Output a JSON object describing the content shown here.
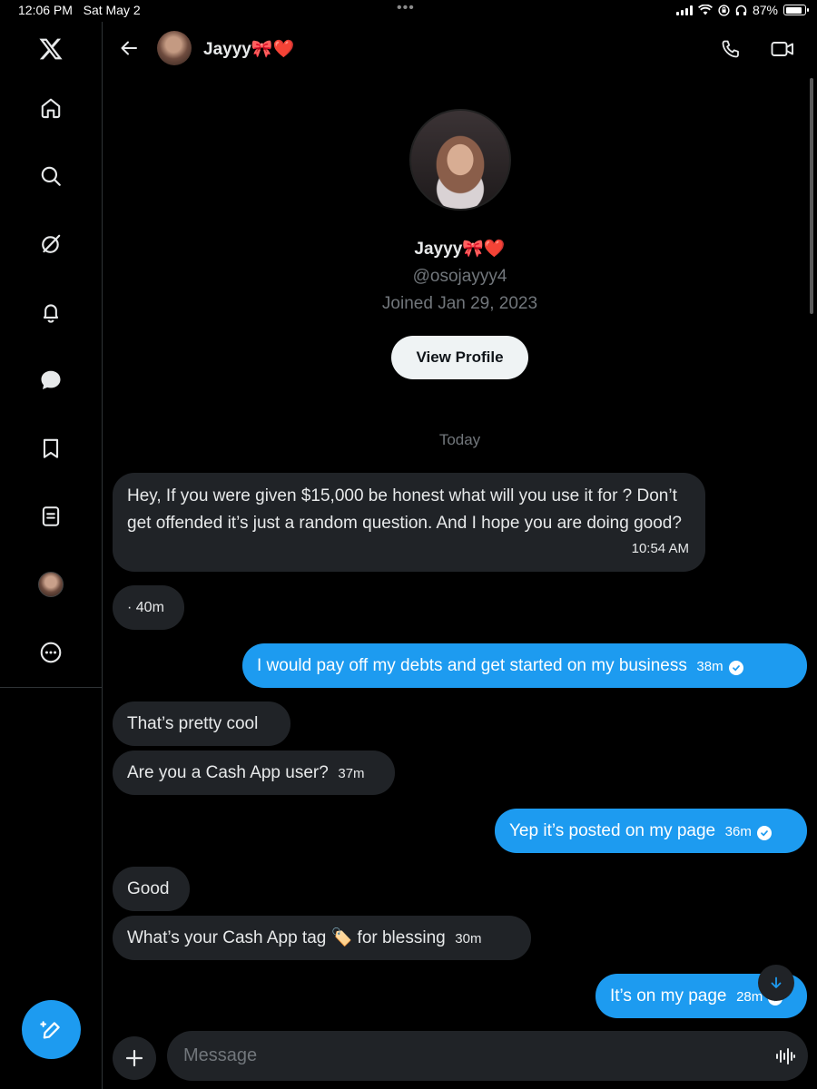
{
  "status_bar": {
    "time": "12:06 PM",
    "date": "Sat May 2",
    "battery": "87%",
    "battery_level": 0.87
  },
  "sidebar": {
    "items": [
      {
        "name": "x-logo-icon"
      },
      {
        "name": "home-icon"
      },
      {
        "name": "search-icon"
      },
      {
        "name": "grok-icon"
      },
      {
        "name": "bell-icon"
      },
      {
        "name": "messages-icon"
      },
      {
        "name": "bookmark-icon"
      },
      {
        "name": "lists-icon"
      },
      {
        "name": "profile-avatar"
      },
      {
        "name": "more-icon"
      }
    ]
  },
  "header": {
    "name": "Jayyy🎀❤️"
  },
  "profile": {
    "name": "Jayyy🎀❤️",
    "handle": "@osojayyy4",
    "joined": "Joined Jan 29, 2023",
    "view_profile_label": "View Profile"
  },
  "day_label": "Today",
  "messages": [
    {
      "dir": "in",
      "text": "Hey, If you were given $15,000 be honest what will you use it for ? Don’t get offended it’s just a random question. And I hope you are doing good?",
      "time": "10:54 AM"
    },
    {
      "dir": "in",
      "text": "· 40m",
      "time": ""
    },
    {
      "dir": "out",
      "text": "I would pay off my debts and get started on my business",
      "time": "38m"
    },
    {
      "dir": "in",
      "text": "That’s pretty cool",
      "time": ""
    },
    {
      "dir": "in",
      "text": "Are you a Cash App user?",
      "time": "37m"
    },
    {
      "dir": "out",
      "text": "Yep it’s posted on my page",
      "time": "36m"
    },
    {
      "dir": "in",
      "text": "Good",
      "time": ""
    },
    {
      "dir": "in",
      "text": "What’s your Cash App tag 🏷️ for blessing",
      "time": "30m"
    },
    {
      "dir": "out",
      "text": "It’s on my page",
      "time": "28m"
    }
  ],
  "composer": {
    "placeholder": "Message"
  }
}
